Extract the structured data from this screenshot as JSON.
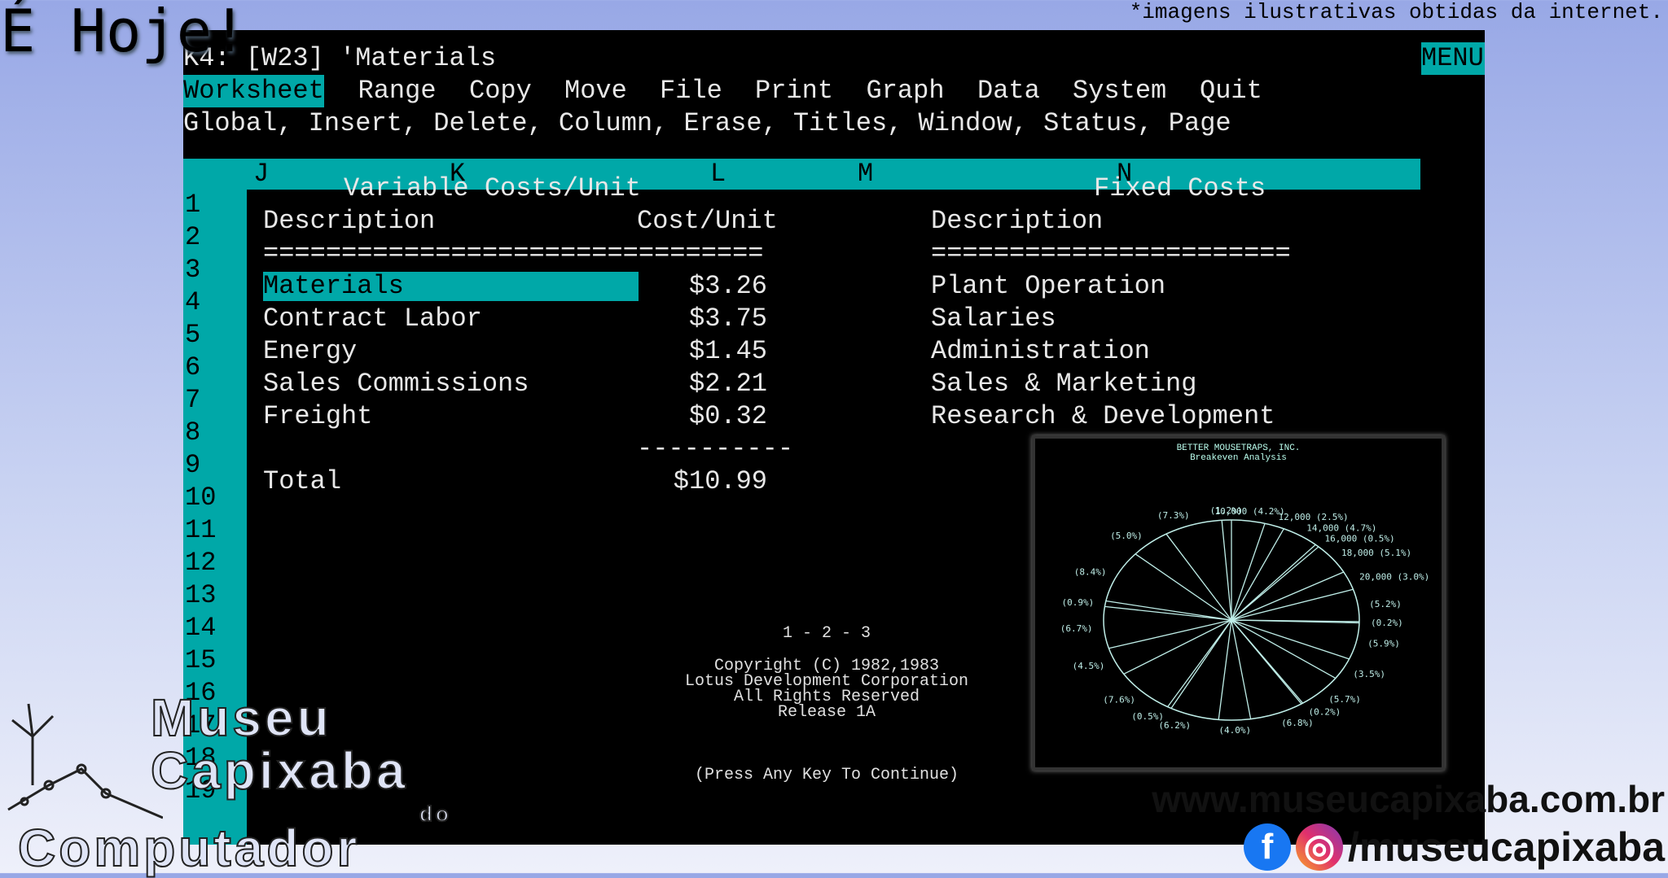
{
  "overlay": {
    "title": "É Hoje!",
    "note": "*imagens ilustrativas obtidas da internet.",
    "website": "www.museucapixaba.com.br",
    "social": "/museucapixaba",
    "logo": {
      "line1": "Museu",
      "line2": "Capixaba",
      "line3": "do",
      "line4": "Computador"
    }
  },
  "status": {
    "cell": "K4: [W23] 'Materials",
    "mode": "MENU"
  },
  "menu": {
    "items": [
      "Worksheet",
      "Range",
      "Copy",
      "Move",
      "File",
      "Print",
      "Graph",
      "Data",
      "System",
      "Quit"
    ],
    "submenu": "Global, Insert, Delete, Column, Erase, Titles, Window, Status, Page"
  },
  "columns": [
    "J",
    "K",
    "L",
    "M",
    "N"
  ],
  "rows": [
    "1",
    "2",
    "3",
    "4",
    "5",
    "6",
    "7",
    "8",
    "9",
    "10",
    "11",
    "12",
    "13",
    "14",
    "15",
    "16",
    "17",
    "18",
    "19"
  ],
  "sheet": {
    "var_title": "Variable Costs/Unit",
    "fixed_title": "Fixed Costs",
    "desc_header": "Description",
    "cost_header": "Cost/Unit",
    "fixed_desc_header": "Description",
    "sep1": "================================",
    "sep2": "=======================",
    "dash": "----------",
    "variable": [
      {
        "desc": "Materials",
        "cost": "$3.26"
      },
      {
        "desc": "Contract Labor",
        "cost": "$3.75"
      },
      {
        "desc": "Energy",
        "cost": "$1.45"
      },
      {
        "desc": "Sales Commissions",
        "cost": "$2.21"
      },
      {
        "desc": "Freight",
        "cost": "$0.32"
      }
    ],
    "fixed": [
      "Plant Operation",
      "Salaries",
      "Administration",
      "Sales & Marketing",
      "Research & Development"
    ],
    "total_label": "Total",
    "total_value": "$10.99"
  },
  "splash": {
    "version": "1 - 2 - 3",
    "copyright": "Copyright (C) 1982,1983",
    "company": "Lotus Development Corporation",
    "rights": "All Rights Reserved",
    "release": "Release 1A",
    "prompt": "(Press Any Key To Continue)"
  },
  "chart_data": {
    "type": "pie",
    "title": "BETTER MOUSETRAPS, INC.",
    "subtitle": "Breakeven Analysis",
    "labels": [
      "10,000 (4.2%)",
      "12,000 (2.5%)",
      "14,000 (4.7%)",
      "16,000 (0.5%)",
      "18,000 (5.1%)",
      "20,000 (3.0%)",
      "(5.2%)",
      "(0.2%)",
      "(5.9%)",
      "(3.5%)",
      "(5.7%)",
      "(0.2%)",
      "(6.8%)",
      "(4.0%)",
      "(6.2%)",
      "(0.5%)",
      "(7.6%)",
      "(4.5%)",
      "(6.7%)",
      "(0.9%)",
      "(8.4%)",
      "(5.0%)",
      "(7.3%)",
      "(1.2%)"
    ],
    "values": [
      4.2,
      2.5,
      4.7,
      0.5,
      5.1,
      3.0,
      5.2,
      0.2,
      5.9,
      3.5,
      5.7,
      0.2,
      6.8,
      4.0,
      6.2,
      0.5,
      7.6,
      4.5,
      6.7,
      0.9,
      8.4,
      5.0,
      7.3,
      1.2
    ],
    "color": "#bfeee8"
  },
  "colors": {
    "accent": "#00a8a8",
    "text": "#e8e8e8"
  }
}
